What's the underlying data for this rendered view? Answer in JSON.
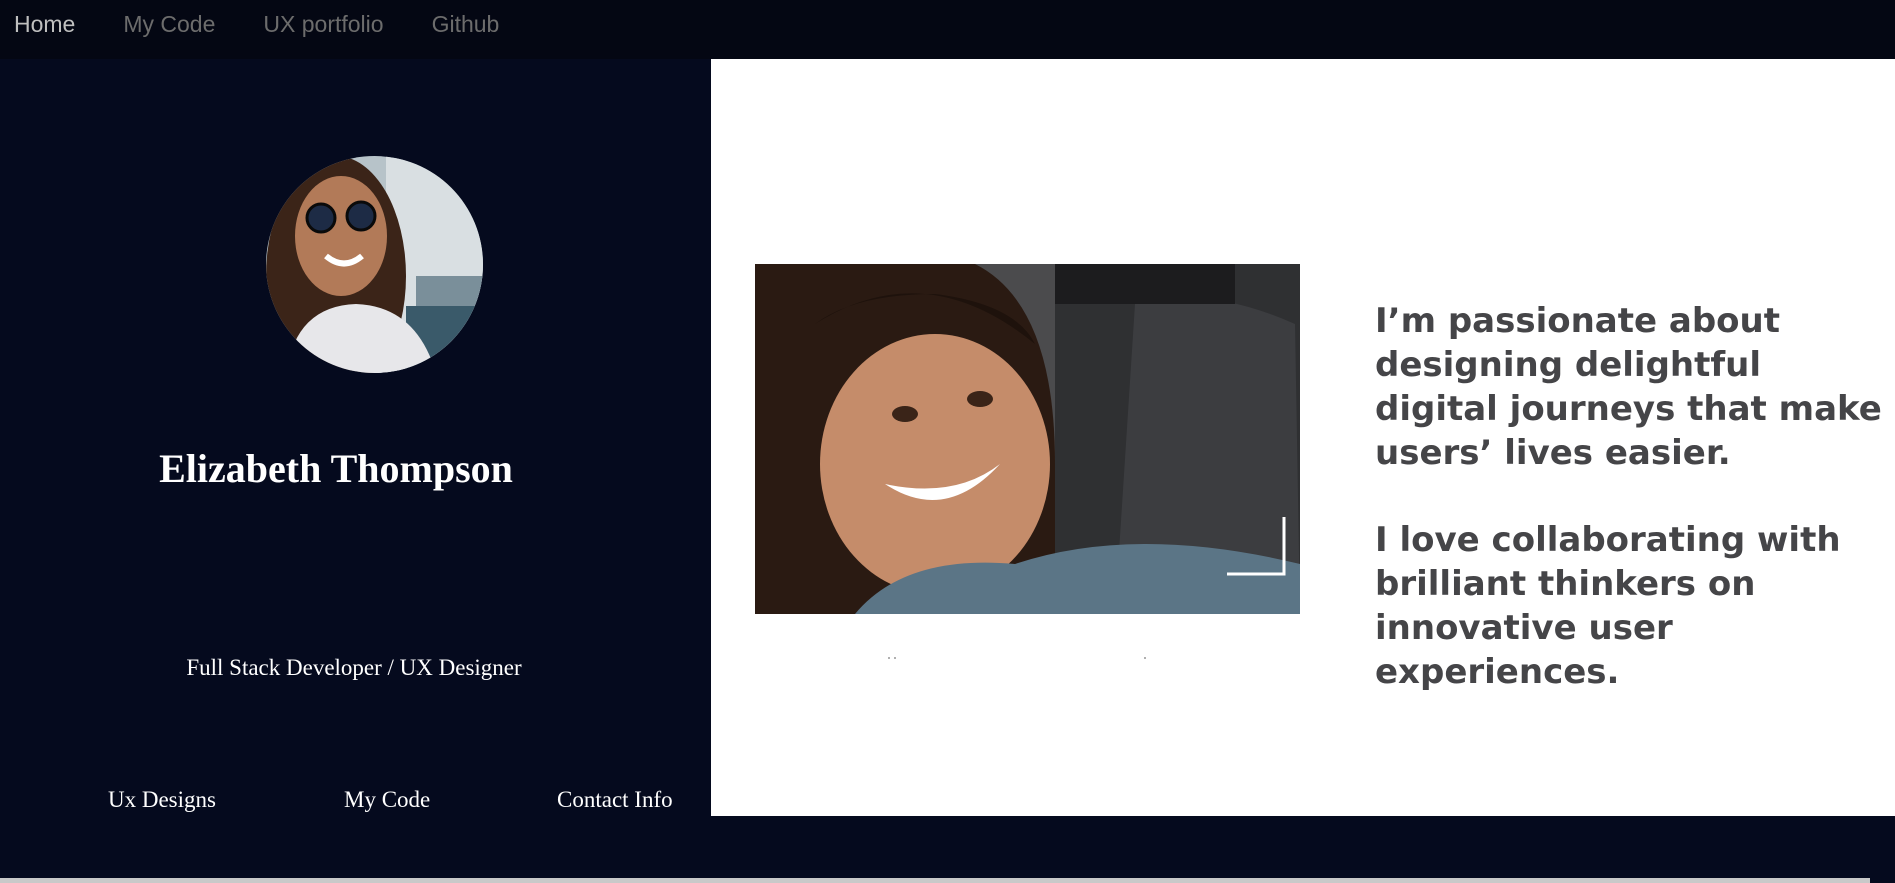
{
  "nav": {
    "items": [
      {
        "label": "Home",
        "active": true
      },
      {
        "label": "My Code",
        "active": false
      },
      {
        "label": "UX portfolio",
        "active": false
      },
      {
        "label": "Github",
        "active": false
      }
    ]
  },
  "profile": {
    "name": "Elizabeth Thompson",
    "role": "Full Stack Developer / UX Designer",
    "links": [
      "Ux Designs",
      "My Code",
      "Contact Info"
    ]
  },
  "content": {
    "paragraph_1": "I’m passionate about designing delightful digital journeys that make users’ lives easier.",
    "paragraph_2": "I love collaborating with brilliant thinkers on innovative user experiences."
  },
  "colors": {
    "page_background": "#050a1e",
    "nav_background": "#040713",
    "content_background": "#ffffff",
    "tagline_text": "#454548"
  }
}
